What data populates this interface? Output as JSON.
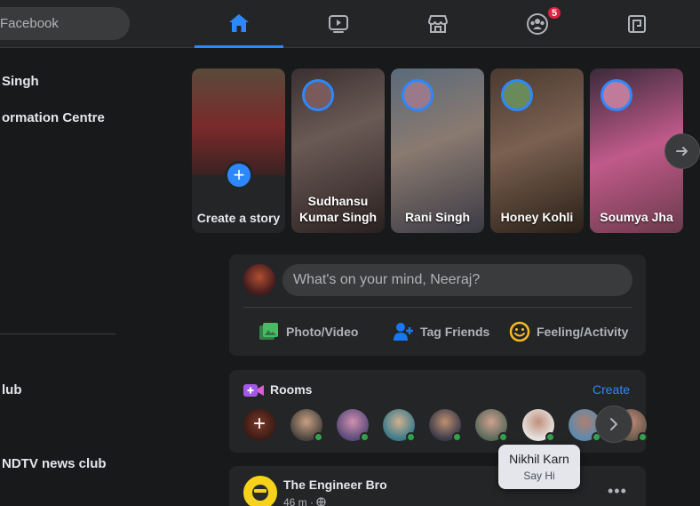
{
  "search": {
    "placeholder": "Facebook"
  },
  "nav": {
    "tabs": [
      {
        "icon": "home-icon",
        "active": true
      },
      {
        "icon": "watch-icon"
      },
      {
        "icon": "marketplace-icon"
      },
      {
        "icon": "groups-icon",
        "badge": "5"
      },
      {
        "icon": "gaming-icon"
      }
    ],
    "accent": "#2d88ff"
  },
  "sidebar": {
    "items": [
      {
        "label": "Singh"
      },
      {
        "label": "ormation Centre"
      },
      {
        "label": "lub"
      },
      {
        "label": "NDTV news club"
      }
    ]
  },
  "stories": {
    "create_label": "Create a story",
    "items": [
      {
        "name": "Sudhansu Kumar Singh"
      },
      {
        "name": "Rani Singh"
      },
      {
        "name": "Honey Kohli"
      },
      {
        "name": "Soumya Jha"
      }
    ]
  },
  "composer": {
    "placeholder": "What's on your mind, Neeraj?",
    "actions": [
      {
        "label": "Photo/Video",
        "icon": "photo-video-icon",
        "color": "#45bd62"
      },
      {
        "label": "Tag Friends",
        "icon": "tag-friends-icon",
        "color": "#1877f2"
      },
      {
        "label": "Feeling/Activity",
        "icon": "feeling-icon",
        "color": "#f7b928"
      }
    ]
  },
  "rooms": {
    "title": "Rooms",
    "create_label": "Create"
  },
  "post": {
    "author": "The Engineer Bro",
    "time": "46 m · "
  },
  "tooltip": {
    "name": "Nikhil Karn",
    "subtitle": "Say Hi"
  }
}
